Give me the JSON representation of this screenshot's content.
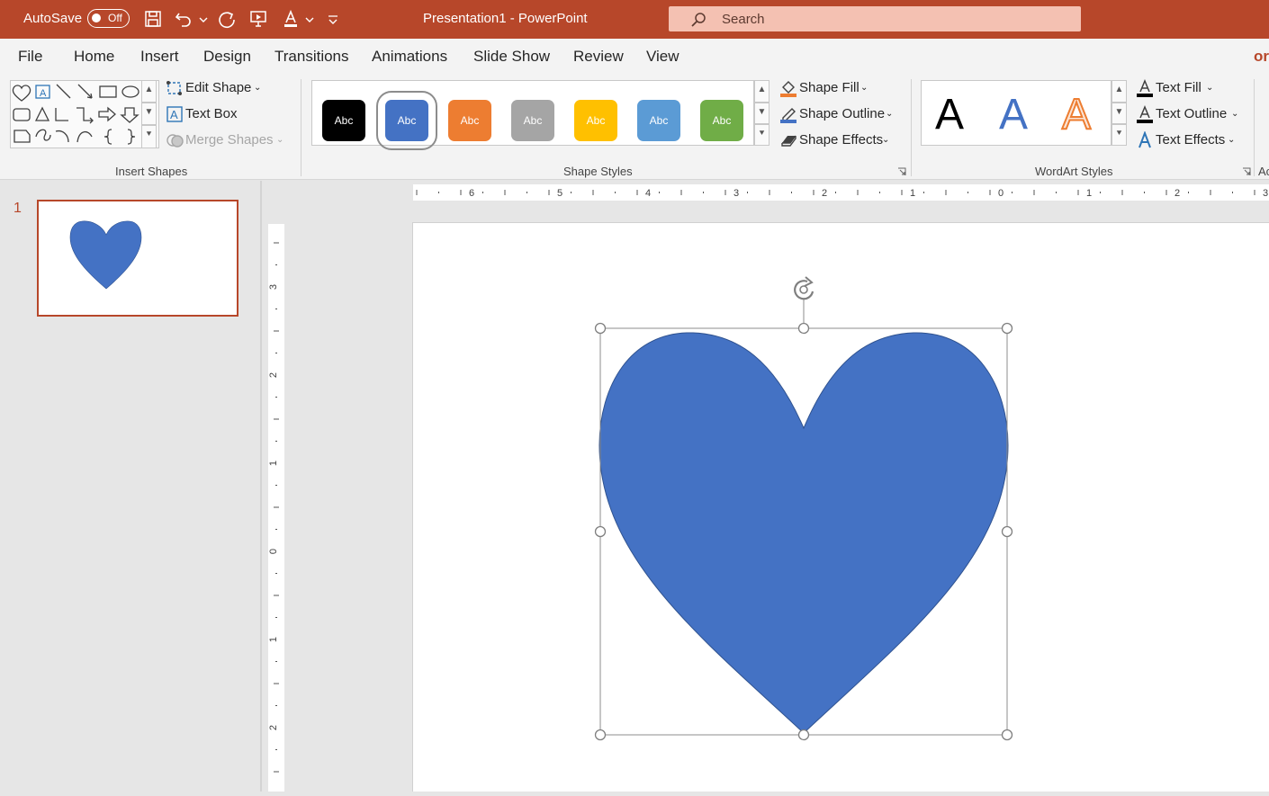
{
  "titlebar": {
    "autosave_label": "AutoSave",
    "autosave_state": "Off",
    "doc_title": "Presentation1  -  PowerPoint",
    "search_placeholder": "Search",
    "background_color": "#b7472a"
  },
  "tabs": [
    {
      "label": "File"
    },
    {
      "label": "Home"
    },
    {
      "label": "Insert"
    },
    {
      "label": "Design"
    },
    {
      "label": "Transitions"
    },
    {
      "label": "Animations"
    },
    {
      "label": "Slide Show"
    },
    {
      "label": "Review"
    },
    {
      "label": "View"
    },
    {
      "label": "or"
    }
  ],
  "ribbon": {
    "insert_shapes": {
      "label": "Insert Shapes",
      "edit_shape": "Edit Shape",
      "text_box": "Text Box",
      "merge_shapes": "Merge Shapes"
    },
    "shape_styles": {
      "label": "Shape Styles",
      "swatches": [
        {
          "text": "Abc",
          "color": "#000000"
        },
        {
          "text": "Abc",
          "color": "#4472c4"
        },
        {
          "text": "Abc",
          "color": "#ed7d31"
        },
        {
          "text": "Abc",
          "color": "#a5a5a5"
        },
        {
          "text": "Abc",
          "color": "#ffc000"
        },
        {
          "text": "Abc",
          "color": "#5b9bd5"
        },
        {
          "text": "Abc",
          "color": "#70ad47"
        }
      ],
      "shape_fill": "Shape Fill",
      "shape_outline": "Shape Outline",
      "shape_effects": "Shape Effects"
    },
    "wordart_styles": {
      "label": "WordArt Styles",
      "samples": [
        "A",
        "A",
        "A"
      ],
      "text_fill": "Text Fill",
      "text_outline": "Text Outline",
      "text_effects": "Text Effects"
    },
    "partial_group_label": "Ac"
  },
  "slides_panel": {
    "slide_number": "1"
  },
  "rulers": {
    "horizontal_labels": [
      "6",
      "5",
      "4",
      "3",
      "2",
      "1",
      "0",
      "1",
      "2",
      "3"
    ],
    "vertical_labels": [
      "3",
      "2",
      "1",
      "0",
      "1",
      "2"
    ]
  },
  "shape": {
    "type": "heart",
    "fill": "#4472c4",
    "outline": "#2f528f"
  }
}
